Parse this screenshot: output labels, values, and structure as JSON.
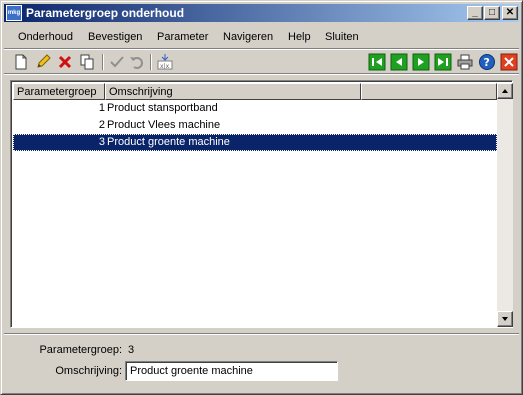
{
  "window": {
    "title": "Parametergroep onderhoud",
    "app_icon_text": "mkg"
  },
  "titlebar_buttons": [
    "_",
    "□",
    "✕"
  ],
  "menu": [
    "Onderhoud",
    "Bevestigen",
    "Parameter",
    "Navigeren",
    "Help",
    "Sluiten"
  ],
  "toolbar": {
    "icons": [
      "new-document-icon",
      "edit-pencil-icon",
      "delete-x-icon",
      "copy-icon",
      "confirm-check-icon",
      "undo-icon",
      "query-icon",
      "first-record-icon",
      "previous-record-icon",
      "next-record-icon",
      "last-record-icon",
      "print-icon",
      "help-icon",
      "close-icon"
    ]
  },
  "grid": {
    "columns": [
      "Parametergroep",
      "Omschrijving",
      ""
    ],
    "rows": [
      {
        "no": "1",
        "desc": "Product stansportband"
      },
      {
        "no": "2",
        "desc": "Product Vlees machine"
      },
      {
        "no": "3",
        "desc": "Product groente machine"
      }
    ],
    "selected_index": 2
  },
  "detail": {
    "group_label": "Parametergroep:",
    "group_value": "3",
    "desc_label": "Omschrijving:",
    "desc_value": "Product groente machine"
  },
  "colors": {
    "titlebar_start": "#0a246a",
    "titlebar_end": "#a6caf0",
    "selection": "#0a246a",
    "face": "#d4d0c8"
  }
}
